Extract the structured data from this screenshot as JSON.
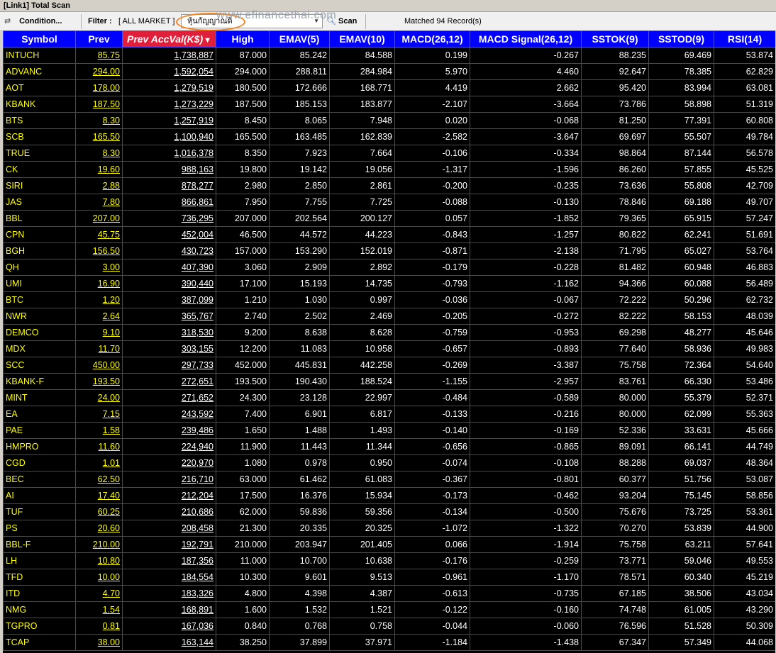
{
  "window": {
    "title": "[Link1] Total Scan"
  },
  "toolbar": {
    "condition_label": "Condition...",
    "filter_label": "Filter :",
    "filter_value": "[ ALL MARKET ]",
    "combo_value": "หุ้นกัญญาณดิ",
    "scan_label": "Scan",
    "status": "Matched 94 Record(s)",
    "watermark": "www.efinancethai.com",
    "highlight_color": "#f5831f"
  },
  "table": {
    "headers": [
      "Symbol",
      "Prev",
      "Prev AccVal(K$)",
      "High",
      "EMAV(5)",
      "EMAV(10)",
      "MACD(26,12)",
      "MACD Signal(26,12)",
      "SSTOK(9)",
      "SSTOD(9)",
      "RSI(14)"
    ],
    "sorted_column": 2,
    "rows": [
      [
        "INTUCH",
        "85.75",
        "1,738,887",
        "87.000",
        "85.242",
        "84.588",
        "0.199",
        "-0.267",
        "88.235",
        "69.469",
        "53.874"
      ],
      [
        "ADVANC",
        "294.00",
        "1,592,054",
        "294.000",
        "288.811",
        "284.984",
        "5.970",
        "4.460",
        "92.647",
        "78.385",
        "62.829"
      ],
      [
        "AOT",
        "178.00",
        "1,279,519",
        "180.500",
        "172.666",
        "168.771",
        "4.419",
        "2.662",
        "95.420",
        "83.994",
        "63.081"
      ],
      [
        "KBANK",
        "187.50",
        "1,273,229",
        "187.500",
        "185.153",
        "183.877",
        "-2.107",
        "-3.664",
        "73.786",
        "58.898",
        "51.319"
      ],
      [
        "BTS",
        "8.30",
        "1,257,919",
        "8.450",
        "8.065",
        "7.948",
        "0.020",
        "-0.068",
        "81.250",
        "77.391",
        "60.808"
      ],
      [
        "SCB",
        "165.50",
        "1,100,940",
        "165.500",
        "163.485",
        "162.839",
        "-2.582",
        "-3.647",
        "69.697",
        "55.507",
        "49.784"
      ],
      [
        "TRUE",
        "8.30",
        "1,016,378",
        "8.350",
        "7.923",
        "7.664",
        "-0.106",
        "-0.334",
        "98.864",
        "87.144",
        "56.578"
      ],
      [
        "CK",
        "19.60",
        "988,163",
        "19.800",
        "19.142",
        "19.056",
        "-1.317",
        "-1.596",
        "86.260",
        "57.855",
        "45.525"
      ],
      [
        "SIRI",
        "2.88",
        "878,277",
        "2.980",
        "2.850",
        "2.861",
        "-0.200",
        "-0.235",
        "73.636",
        "55.808",
        "42.709"
      ],
      [
        "JAS",
        "7.80",
        "866,861",
        "7.950",
        "7.755",
        "7.725",
        "-0.088",
        "-0.130",
        "78.846",
        "69.188",
        "49.707"
      ],
      [
        "BBL",
        "207.00",
        "736,295",
        "207.000",
        "202.564",
        "200.127",
        "0.057",
        "-1.852",
        "79.365",
        "65.915",
        "57.247"
      ],
      [
        "CPN",
        "45.75",
        "452,004",
        "46.500",
        "44.572",
        "44.223",
        "-0.843",
        "-1.257",
        "80.822",
        "62.241",
        "51.691"
      ],
      [
        "BGH",
        "156.50",
        "430,723",
        "157.000",
        "153.290",
        "152.019",
        "-0.871",
        "-2.138",
        "71.795",
        "65.027",
        "53.764"
      ],
      [
        "QH",
        "3.00",
        "407,390",
        "3.060",
        "2.909",
        "2.892",
        "-0.179",
        "-0.228",
        "81.482",
        "60.948",
        "46.883"
      ],
      [
        "UMI",
        "16.90",
        "390,440",
        "17.100",
        "15.193",
        "14.735",
        "-0.793",
        "-1.162",
        "94.366",
        "60.088",
        "56.489"
      ],
      [
        "BTC",
        "1.20",
        "387,099",
        "1.210",
        "1.030",
        "0.997",
        "-0.036",
        "-0.067",
        "72.222",
        "50.296",
        "62.732"
      ],
      [
        "NWR",
        "2.64",
        "365,767",
        "2.740",
        "2.502",
        "2.469",
        "-0.205",
        "-0.272",
        "82.222",
        "58.153",
        "48.039"
      ],
      [
        "DEMCO",
        "9.10",
        "318,530",
        "9.200",
        "8.638",
        "8.628",
        "-0.759",
        "-0.953",
        "69.298",
        "48.277",
        "45.646"
      ],
      [
        "MDX",
        "11.70",
        "303,155",
        "12.200",
        "11.083",
        "10.958",
        "-0.657",
        "-0.893",
        "77.640",
        "58.936",
        "49.983"
      ],
      [
        "SCC",
        "450.00",
        "297,733",
        "452.000",
        "445.831",
        "442.258",
        "-0.269",
        "-3.387",
        "75.758",
        "72.364",
        "54.640"
      ],
      [
        "KBANK-F",
        "193.50",
        "272,651",
        "193.500",
        "190.430",
        "188.524",
        "-1.155",
        "-2.957",
        "83.761",
        "66.330",
        "53.486"
      ],
      [
        "MINT",
        "24.00",
        "271,652",
        "24.300",
        "23.128",
        "22.997",
        "-0.484",
        "-0.589",
        "80.000",
        "55.379",
        "52.371"
      ],
      [
        "EA",
        "7.15",
        "243,592",
        "7.400",
        "6.901",
        "6.817",
        "-0.133",
        "-0.216",
        "80.000",
        "62.099",
        "55.363"
      ],
      [
        "PAE",
        "1.58",
        "239,486",
        "1.650",
        "1.488",
        "1.493",
        "-0.140",
        "-0.169",
        "52.336",
        "33.631",
        "45.666"
      ],
      [
        "HMPRO",
        "11.60",
        "224,940",
        "11.900",
        "11.443",
        "11.344",
        "-0.656",
        "-0.865",
        "89.091",
        "66.141",
        "44.749"
      ],
      [
        "CGD",
        "1.01",
        "220,970",
        "1.080",
        "0.978",
        "0.950",
        "-0.074",
        "-0.108",
        "88.288",
        "69.037",
        "48.364"
      ],
      [
        "BEC",
        "62.50",
        "216,710",
        "63.000",
        "61.462",
        "61.083",
        "-0.367",
        "-0.801",
        "60.377",
        "51.756",
        "53.087"
      ],
      [
        "AI",
        "17.40",
        "212,204",
        "17.500",
        "16.376",
        "15.934",
        "-0.173",
        "-0.462",
        "93.204",
        "75.145",
        "58.856"
      ],
      [
        "TUF",
        "60.25",
        "210,686",
        "62.000",
        "59.836",
        "59.356",
        "-0.134",
        "-0.500",
        "75.676",
        "73.725",
        "53.361"
      ],
      [
        "PS",
        "20.60",
        "208,458",
        "21.300",
        "20.335",
        "20.325",
        "-1.072",
        "-1.322",
        "70.270",
        "53.839",
        "44.900"
      ],
      [
        "BBL-F",
        "210.00",
        "192,791",
        "210.000",
        "203.947",
        "201.405",
        "0.066",
        "-1.914",
        "75.758",
        "63.211",
        "57.641"
      ],
      [
        "LH",
        "10.80",
        "187,356",
        "11.000",
        "10.700",
        "10.638",
        "-0.176",
        "-0.259",
        "73.771",
        "59.046",
        "49.553"
      ],
      [
        "TFD",
        "10.00",
        "184,554",
        "10.300",
        "9.601",
        "9.513",
        "-0.961",
        "-1.170",
        "78.571",
        "60.340",
        "45.219"
      ],
      [
        "ITD",
        "4.70",
        "183,326",
        "4.800",
        "4.398",
        "4.387",
        "-0.613",
        "-0.735",
        "67.185",
        "38.506",
        "43.034"
      ],
      [
        "NMG",
        "1.54",
        "168,891",
        "1.600",
        "1.532",
        "1.521",
        "-0.122",
        "-0.160",
        "74.748",
        "61.005",
        "43.290"
      ],
      [
        "TGPRO",
        "0.81",
        "167,036",
        "0.840",
        "0.768",
        "0.758",
        "-0.044",
        "-0.060",
        "76.596",
        "51.528",
        "50.309"
      ],
      [
        "TCAP",
        "38.00",
        "163,144",
        "38.250",
        "37.899",
        "37.971",
        "-1.184",
        "-1.438",
        "67.347",
        "57.349",
        "44.068"
      ]
    ]
  }
}
